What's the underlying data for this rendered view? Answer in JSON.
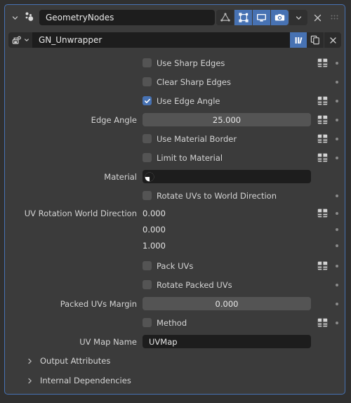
{
  "modifier": {
    "icon": "geometry-nodes-icon",
    "name": "GeometryNodes",
    "expand_icon": "chevron-down-icon",
    "toggles": [
      {
        "name": "show-on-cage-toggle",
        "icon": "mesh-data-icon",
        "enabled": false
      },
      {
        "name": "show-in-edit-mode-toggle",
        "icon": "edit-mode-icon",
        "enabled": true
      },
      {
        "name": "show-in-viewport-toggle",
        "icon": "display-icon",
        "enabled": true
      },
      {
        "name": "show-in-render-toggle",
        "icon": "camera-icon",
        "enabled": true
      }
    ],
    "dropdown_icon": "chevron-down-icon",
    "close_icon": "close-x-icon",
    "grip_icon": "drag-grip-icon"
  },
  "node_group": {
    "browse_icon": "browse-node-group-icon",
    "browse_chevron": "chevron-down-icon",
    "name": "GN_Unwrapper",
    "fake_user_icon": "fake-user-shield-icon",
    "fake_user_enabled": true,
    "new_icon": "new-copy-icon",
    "unlink_icon": "unlink-x-icon"
  },
  "properties": [
    {
      "kind": "checkbox",
      "label": "Use Sharp Edges",
      "checked": false,
      "attr_icon": true,
      "decorator": true
    },
    {
      "kind": "checkbox",
      "label": "Clear Sharp Edges",
      "checked": false,
      "attr_icon": false,
      "decorator": true
    },
    {
      "kind": "checkbox",
      "label": "Use Edge Angle",
      "checked": true,
      "attr_icon": true,
      "decorator": true
    },
    {
      "kind": "value",
      "label": "Edge Angle",
      "value": "25.000",
      "attr_icon": true,
      "decorator": true
    },
    {
      "kind": "checkbox",
      "label": "Use Material Border",
      "checked": false,
      "attr_icon": true,
      "decorator": true
    },
    {
      "kind": "checkbox",
      "label": "Limit to Material",
      "checked": false,
      "attr_icon": true,
      "decorator": true
    },
    {
      "kind": "material",
      "label": "Material",
      "value": "",
      "icon": "material-sphere-icon",
      "attr_icon": false,
      "decorator": false
    },
    {
      "kind": "checkbox",
      "label": "Rotate UVs to World Direction",
      "checked": false,
      "attr_icon": false,
      "decorator": true
    },
    {
      "kind": "vector",
      "label": "UV Rotation World Direction",
      "values": [
        "0.000",
        "0.000",
        "1.000"
      ],
      "attr_icon": true,
      "decorator": true
    },
    {
      "kind": "checkbox",
      "label": "Pack UVs",
      "checked": false,
      "attr_icon": true,
      "decorator": true
    },
    {
      "kind": "checkbox",
      "label": "Rotate Packed UVs",
      "checked": false,
      "attr_icon": false,
      "decorator": true
    },
    {
      "kind": "value",
      "label": "Packed UVs Margin",
      "value": "0.000",
      "attr_icon": false,
      "decorator": true
    },
    {
      "kind": "checkbox",
      "label": "Method",
      "checked": false,
      "attr_icon": true,
      "decorator": true
    },
    {
      "kind": "text",
      "label": "UV Map Name",
      "value": "UVMap",
      "attr_icon": false,
      "decorator": false
    }
  ],
  "subpanels": [
    {
      "label": "Output Attributes",
      "chevron": "chevron-right-icon"
    },
    {
      "label": "Internal Dependencies",
      "chevron": "chevron-right-icon"
    }
  ],
  "colors": {
    "accent_blue": "#4772b3",
    "panel_bg": "#3b3b3b",
    "window_bg": "#303030",
    "field_bg": "#545454",
    "text_field_bg": "#1d1d1d",
    "text": "#e5e5e5"
  }
}
